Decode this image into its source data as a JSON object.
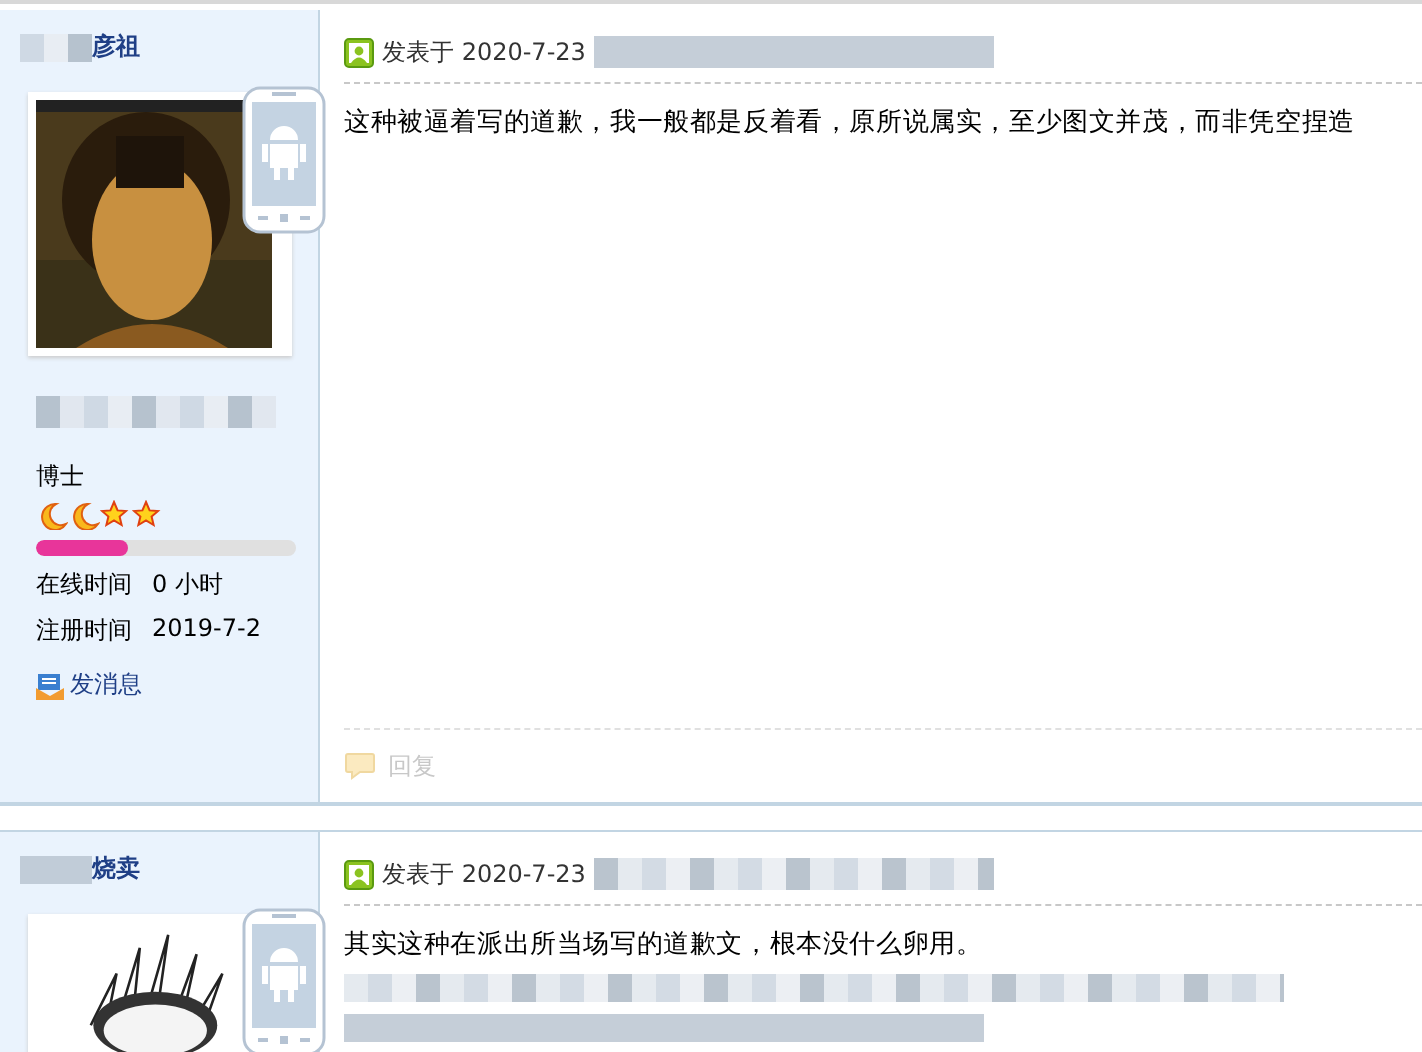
{
  "posts": [
    {
      "username": "彦祖",
      "avatar": {
        "kind": "picture"
      },
      "posted": "发表于 2020-7-23",
      "body": [
        "这种被逼着写的道歉，我一般都是反着看，原所说属实，至少图文并茂，而非凭空捏造"
      ],
      "rank": "博士",
      "level": 0.35,
      "stats": [
        {
          "label": "在线时间",
          "value": "0 小时"
        },
        {
          "label": "注册时间",
          "value": "2019-7-2"
        }
      ],
      "message_link": "发消息",
      "reply": "回复"
    },
    {
      "username": "烧卖",
      "avatar": {
        "kind": "picture"
      },
      "posted": "发表于 2020-7-23",
      "body": [
        "其实这种在派出所当场写的道歉文，根本没什么卵用。"
      ]
    }
  ]
}
